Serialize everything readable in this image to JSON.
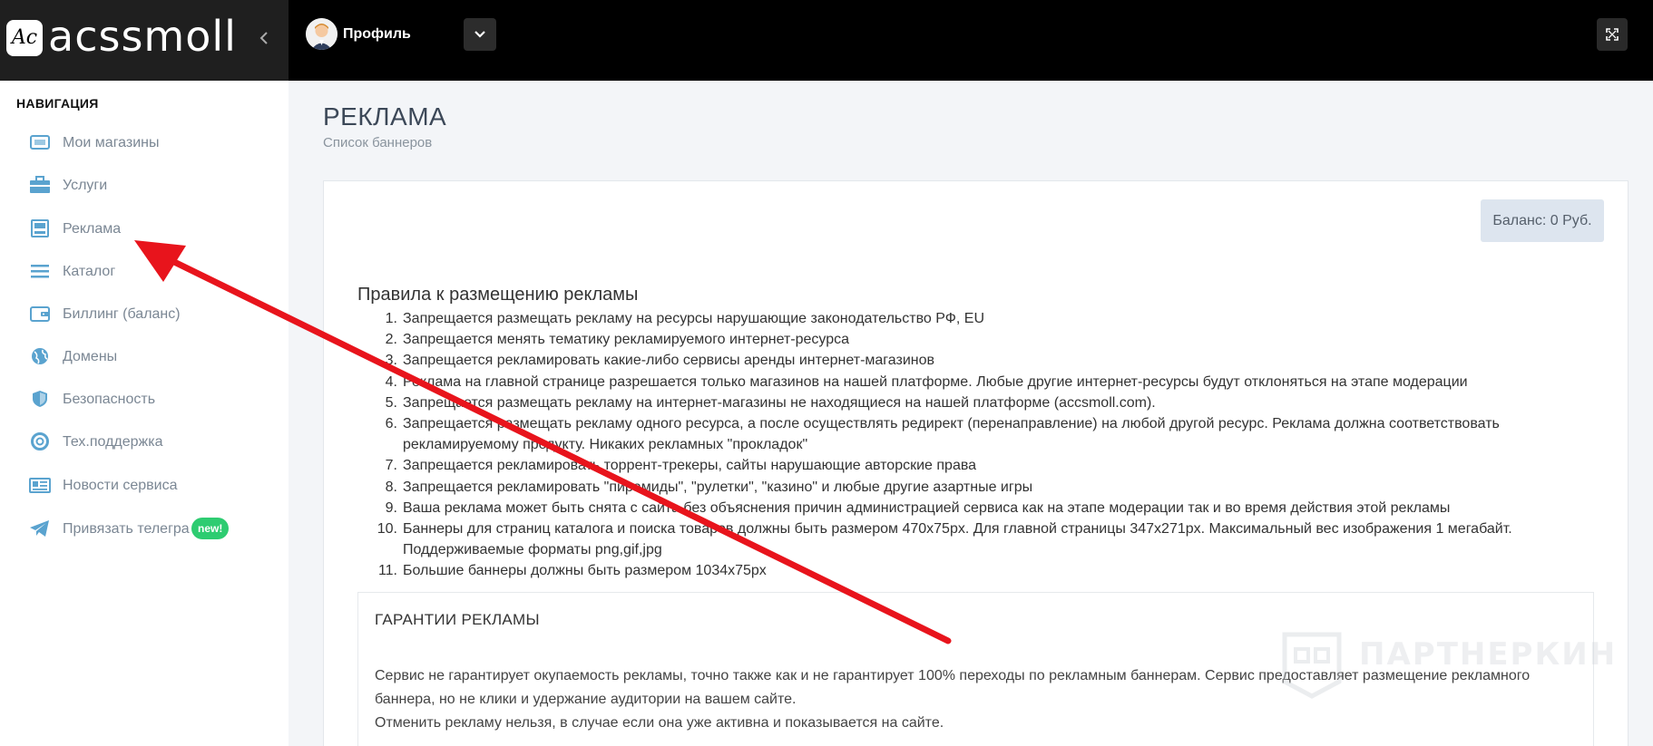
{
  "header": {
    "logo_badge": "Ac",
    "logo_text": "acssmoll",
    "profile_label": "Профиль"
  },
  "sidebar": {
    "heading": "НАВИГАЦИЯ",
    "items": [
      {
        "label": "Мои магазины",
        "icon": "store-icon"
      },
      {
        "label": "Услуги",
        "icon": "briefcase-icon"
      },
      {
        "label": "Реклама",
        "icon": "banner-icon"
      },
      {
        "label": "Каталог",
        "icon": "list-icon"
      },
      {
        "label": "Биллинг (баланс)",
        "icon": "wallet-icon"
      },
      {
        "label": "Домены",
        "icon": "globe-icon"
      },
      {
        "label": "Безопасность",
        "icon": "shield-icon"
      },
      {
        "label": "Тех.поддержка",
        "icon": "lifebuoy-icon"
      },
      {
        "label": "Новости сервиса",
        "icon": "newspaper-icon"
      },
      {
        "label": "Привязать телегра",
        "icon": "telegram-icon",
        "badge": "new!"
      }
    ]
  },
  "main": {
    "title": "РЕКЛАМА",
    "subtitle": "Список баннеров",
    "balance": "Баланс: 0 Руб.",
    "rules_title": "Правила к размещению рекламы",
    "rules": [
      "Запрещается размещать рекламу на ресурсы нарушающие законодательство РФ, EU",
      "Запрещается менять тематику рекламируемого интернет-ресурса",
      "Запрещается рекламировать какие-либо сервисы аренды интернет-магазинов",
      "Реклама на главной странице разрешается только магазинов на нашей платформе. Любые другие интернет-ресурсы будут отклоняться на этапе модерации",
      "Запрещается размещать рекламу на интернет-магазины не находящиеся на нашей платформе (accsmoll.com).",
      "Запрещается размещать рекламу одного ресурса, а после осуществлять редирект (перенаправление) на любой другой ресурс. Реклама должна соответствовать рекламируемому продукту. Никаких рекламных \"прокладок\"",
      "Запрещается рекламировать торрент-трекеры, сайты нарушающие авторские права",
      "Запрещается рекламировать \"пирамиды\", \"рулетки\", \"казино\" и любые другие азартные игры",
      "Ваша реклама может быть снята с сайта без объяснения причин администрацией сервиса как на этапе модерации так и во время действия этой рекламы",
      "Баннеры для страниц каталога и поиска товаров должны быть размером 470x75px. Для главной страницы 347x271px. Максимальный вес изображения 1 мегабайт. Поддерживаемые форматы png,gif,jpg",
      "Большие баннеры должны быть размером 1034x75px"
    ],
    "guarantee_title": "ГАРАНТИИ РЕКЛАМЫ",
    "guarantee_text_1": "Сервис не гарантирует окупаемость рекламы, точно также как и не гарантирует 100% переходы по рекламным баннерам. Сервис предоставляет размещение рекламного баннера, но не клики и удержание аудитории на вашем сайте.",
    "guarantee_text_2": "Отменить рекламу нельзя, в случае если она уже активна и показывается на сайте.",
    "watermark": "ПАРТНЕРКИН"
  },
  "colors": {
    "topbar": "#000000",
    "sidebar_text": "#7b8794",
    "icon_blue": "#5aa3cf",
    "badge_green": "#2ecc71",
    "arrow_red": "#e8141c"
  }
}
